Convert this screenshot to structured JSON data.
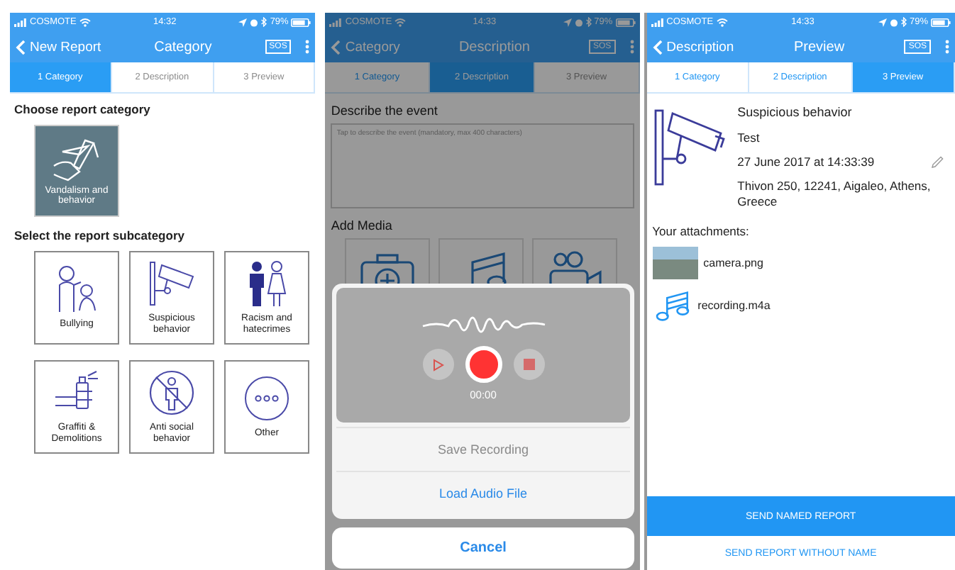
{
  "screens": [
    {
      "kind": "category",
      "status_bar": {
        "carrier": "COSMOTE",
        "time": "14:32",
        "battery": "79%"
      },
      "nav": {
        "back": "New Report",
        "title": "Category",
        "sos": "SOS"
      },
      "tabs": [
        {
          "label": "1 Category",
          "selected": true,
          "disabled": false
        },
        {
          "label": "2 Description",
          "selected": false,
          "disabled": true
        },
        {
          "label": "3 Preview",
          "selected": false,
          "disabled": true
        }
      ],
      "heading": "Choose report category",
      "categories": [
        {
          "label": "Vandalism and behavior",
          "selected": true
        }
      ],
      "subheading": "Select the report subcategory",
      "subcategories": [
        {
          "label": "Bullying"
        },
        {
          "label": "Suspicious behavior"
        },
        {
          "label": "Racism and hatecrimes"
        },
        {
          "label": "Graffiti & Demolitions"
        },
        {
          "label": "Anti social behavior"
        },
        {
          "label": "Other"
        }
      ]
    },
    {
      "kind": "description",
      "status_bar": {
        "carrier": "COSMOTE",
        "time": "14:33",
        "battery": "79%"
      },
      "nav": {
        "back": "Category",
        "title": "Description",
        "sos": "SOS"
      },
      "tabs": [
        {
          "label": "1 Category",
          "selected": false,
          "disabled": false
        },
        {
          "label": "2 Description",
          "selected": true,
          "disabled": false
        },
        {
          "label": "3 Preview",
          "selected": false,
          "disabled": true
        }
      ],
      "heading": "Describe the event",
      "placeholder": "Tap to describe the event (mandatory, max 400 characters)",
      "media_heading": "Add Media",
      "sheet": {
        "time": "00:00",
        "actions": [
          {
            "label": "Save Recording",
            "disabled": true
          },
          {
            "label": "Load Audio File",
            "disabled": false
          }
        ],
        "cancel": "Cancel"
      }
    },
    {
      "kind": "preview",
      "status_bar": {
        "carrier": "COSMOTE",
        "time": "14:33",
        "battery": "79%"
      },
      "nav": {
        "back": "Description",
        "title": "Preview",
        "sos": "SOS"
      },
      "tabs": [
        {
          "label": "1 Category",
          "selected": false,
          "disabled": false
        },
        {
          "label": "2 Description",
          "selected": false,
          "disabled": false
        },
        {
          "label": "3 Preview",
          "selected": true,
          "disabled": false
        }
      ],
      "report": {
        "title": "Suspicious behavior",
        "description": "Test",
        "date": "27 June 2017 at 14:33:39",
        "address": "Thivon 250, 12241, Aigaleo, Athens, Greece"
      },
      "attachments_heading": "Your attachments:",
      "attachments": [
        {
          "kind": "image",
          "name": "camera.png"
        },
        {
          "kind": "audio",
          "name": "recording.m4a"
        }
      ],
      "buttons": [
        {
          "kind": "primary",
          "label": "SEND NAMED REPORT"
        },
        {
          "kind": "link",
          "label": "SEND REPORT WITHOUT NAME"
        }
      ]
    }
  ]
}
